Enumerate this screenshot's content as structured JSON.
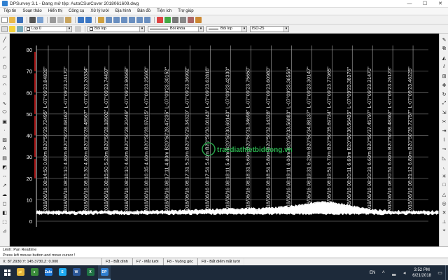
{
  "window": {
    "title": "DPSurvey 3.1 - Đang mở tệp: AutoCSurCover 2018061609.dwg",
    "controls": {
      "minimize": "—",
      "maximize": "☐",
      "close": "✕"
    }
  },
  "menu": [
    "Tệp tin",
    "Soạn thảo",
    "Hiển thị",
    "Công cụ",
    "Xử lý lưới",
    "Địa hình",
    "Bản đồ",
    "Tiện ích",
    "Trợ giúp"
  ],
  "toolbar2": {
    "layer": "Lop 0",
    "color": "Bói lop",
    "linetype": "Bói khóa",
    "lineweight": "Bói lop",
    "textstyle": "ISO-25"
  },
  "canvas": {
    "y_ticks": [
      "80",
      "70",
      "60",
      "50",
      "40",
      "30",
      "20",
      "10",
      "0"
    ],
    "station_labels": [
      "2018/06/16 08:14:50 0.80m B20°50'29.72495\" L-07°09'23.84826\"",
      "2018/06/16 08:15:10 4.80m B20°50'28.68162\" L-07°09'23.24170\"",
      "2018/06/16 08:15:30 4.80m B20°50'28.48567\" L-07°09'23.20334\"",
      "2018/06/16 08:15:50 5.20m B20°50'28.18902\" L-07°09'23.74497\"",
      "2018/06/16 08:16:10 4.60m B20°50'28.20449\" L-07°09'23.90669\"",
      "2018/06/16 08:16:35 4.60m B20°50'28.97415\" L-07°09'23.25690\"",
      "2018/06/16 08:17:11 4.80m B20°50'28.47235\" L-07°09'23.30152\"",
      "2018/06/16 08:17:31 5.20m B20°50'29.34320\" L-07°09'23.36992\"",
      "2018/06/16 08:17:51 5.40m B20°50'30.06143\" L-07°09'23.62816\"",
      "2018/06/16 08:18:11 5.40m B20°50'30.69143\" L-07°09'23.42330\"",
      "2018/06/16 08:18:31 5.60m B20°50'31.34698\" L-07°09'23.75650\"",
      "2018/06/16 08:18:51 5.80m B20°50'32.14328\" L-07°09'23.60980\"",
      "2018/06/16 08:19:11 6.00m B20°50'33.56883\" L-07°09'23.36556\"",
      "2018/06/16 08:19:31 6.20m B20°50'34.88137\" L-07°09'23.30147\"",
      "2018/06/16 08:19:51 6.70m B20°50'35.69734\" L-07°09'23.77965\"",
      "2018/06/16 08:20:11 6.60m B20°50'36.56435\" L-07°09'23.38376\"",
      "2018/06/16 08:20:31 6.60m B20°50'37.45797\" L-07°09'23.31470\"",
      "2018/06/16 08:20:51 6.80m B20°50'38.48362\" L-07°09'23.26123\"",
      "2018/06/16 08:21:12 6.80m B20°50'39.72757\" L-07°09'23.46225\""
    ],
    "watermark": "tracdiathietbiduong.vn"
  },
  "command": {
    "line1": "Lệnh:  Pan Realtime",
    "line2": "Press left mouse button and move cursor !"
  },
  "status": {
    "coords": "X: 87.2930,Y: 145.3730,Z: 0.000",
    "fkeys": [
      "F3 - Bắt dính",
      "F7 - Mắt lưới",
      "F8 - Vuông góc",
      "F9 - Bắt điểm mắt lưới"
    ]
  },
  "taskbar": {
    "apps": [
      {
        "name": "windows-explorer-icon",
        "label": "📁",
        "color": "#e3b53a",
        "active": false
      },
      {
        "name": "chrome-icon",
        "label": "●",
        "color": "#3a8b3a",
        "active": false
      },
      {
        "name": "zalo-icon",
        "label": "Zalo",
        "color": "#1f7ad8",
        "active": false
      },
      {
        "name": "skype-icon",
        "label": "S",
        "color": "#1eaaf1",
        "active": false
      },
      {
        "name": "word-icon",
        "label": "W",
        "color": "#2b5797",
        "active": false
      },
      {
        "name": "excel-icon",
        "label": "X",
        "color": "#1f7244",
        "active": false
      },
      {
        "name": "dpsurvey-icon",
        "label": "DP",
        "color": "#2f7fd0",
        "active": true
      }
    ],
    "lang": "EN",
    "time": "3:52 PM",
    "date": "6/21/2018"
  }
}
